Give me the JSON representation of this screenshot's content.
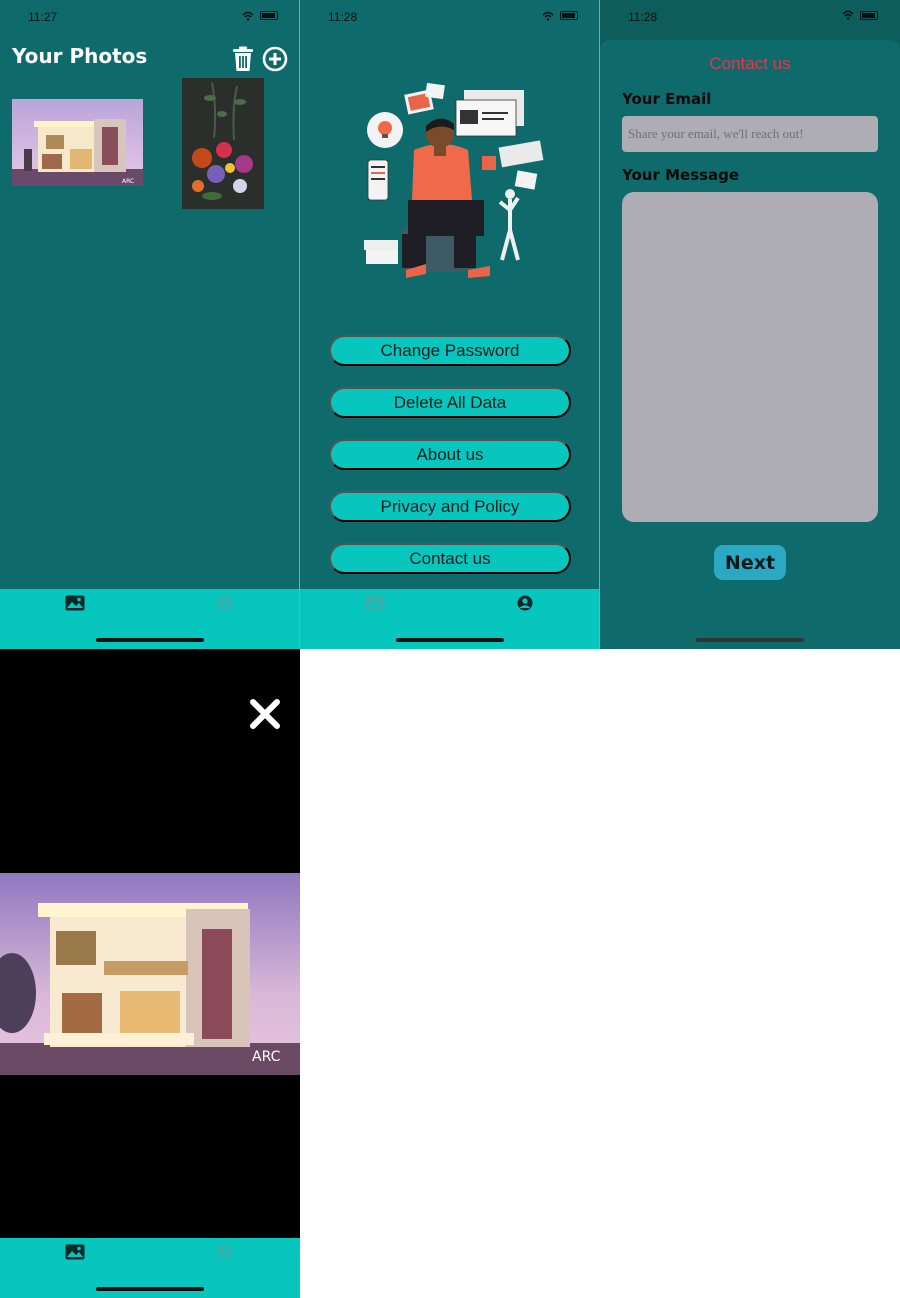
{
  "screen1": {
    "status_time": "11:27",
    "title": "Your Photos",
    "icons": [
      "trash-icon",
      "add-circle-icon"
    ],
    "tabs": [
      "photos-tab-icon",
      "profile-tab-icon"
    ]
  },
  "screen2": {
    "status_time": "11:28",
    "menu": {
      "change_password": "Change Password",
      "delete_all_data": "Delete All Data",
      "about_us": "About us",
      "privacy_policy": "Privacy and Policy",
      "contact_us": "Contact us"
    }
  },
  "screen3": {
    "status_time": "11:28",
    "title": "Contact us",
    "email_label": "Your Email",
    "email_placeholder": "Share your email, we'll reach out!",
    "email_value": "",
    "message_label": "Your Message",
    "next_label": "Next"
  },
  "screen4": {
    "icons": [
      "close-icon"
    ]
  },
  "colors": {
    "background": "#0f6a6b",
    "tabbar": "#06c6bd",
    "title_accent": "#e8334a",
    "input_bg": "#adadb3",
    "next_button": "#2aa8c4"
  }
}
